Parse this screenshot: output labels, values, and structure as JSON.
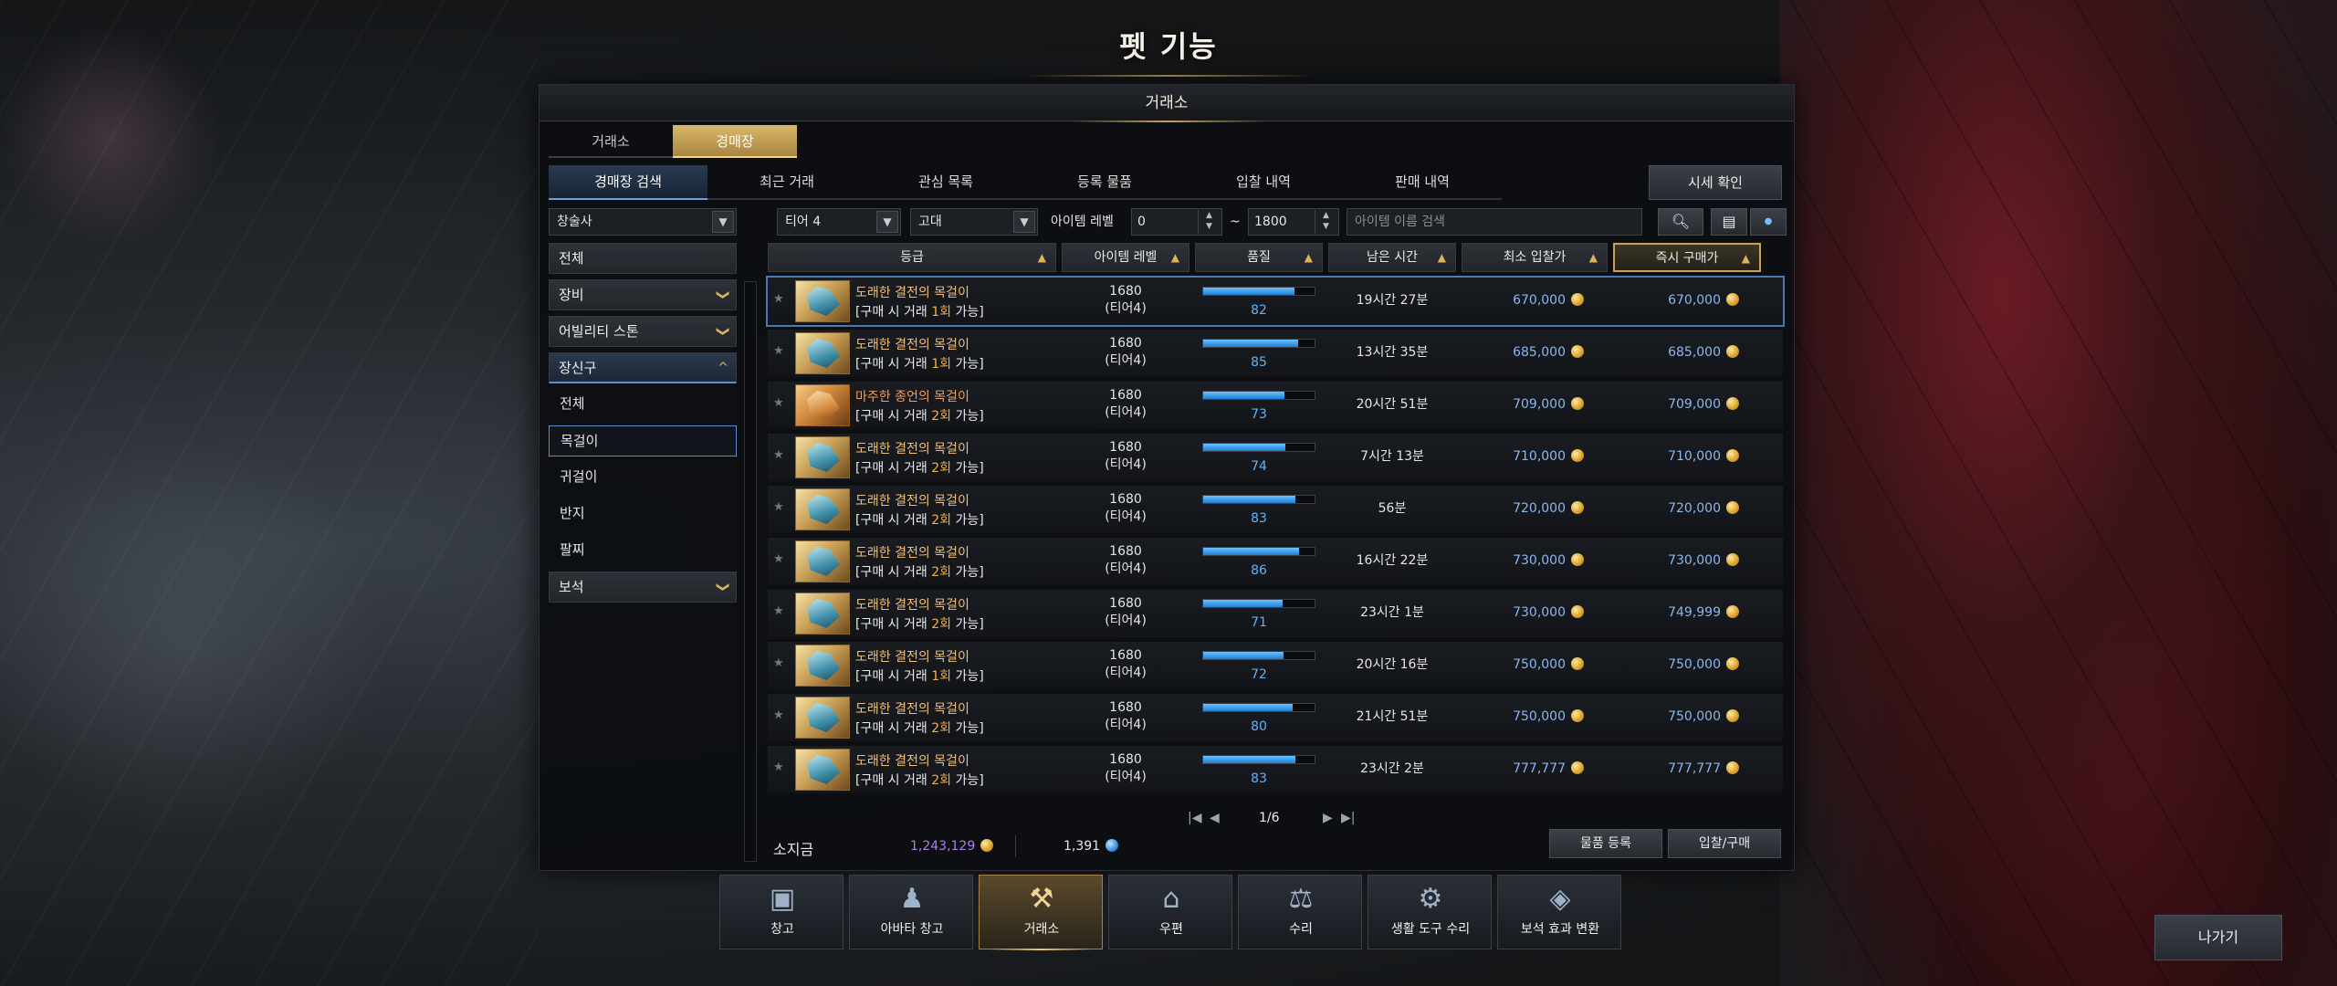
{
  "page_title": "펫 기능",
  "window_title": "거래소",
  "top_tabs": [
    {
      "label": "거래소",
      "active": false
    },
    {
      "label": "경매장",
      "active": true
    }
  ],
  "sub_tabs": [
    {
      "label": "경매장 검색",
      "active": true
    },
    {
      "label": "최근 거래",
      "active": false
    },
    {
      "label": "관심 목록",
      "active": false
    },
    {
      "label": "등록 물품",
      "active": false
    },
    {
      "label": "입찰 내역",
      "active": false
    },
    {
      "label": "판매 내역",
      "active": false
    }
  ],
  "price_check_label": "시세 확인",
  "filters": {
    "class_select": "창술사",
    "tier_select": "티어 4",
    "grade_select": "고대",
    "item_level_label": "아이템 레벨",
    "level_min": "0",
    "level_sep": "~",
    "level_max": "1800",
    "search_placeholder": "아이템 이름 검색",
    "search_icon": "search-icon",
    "detail_search_icon": "detail-search-icon",
    "toggle_dot": "●"
  },
  "sidebar": {
    "categories": [
      {
        "label": "전체",
        "type": "cat"
      },
      {
        "label": "장비",
        "type": "cat",
        "arrow": "❯"
      },
      {
        "label": "어빌리티 스톤",
        "type": "cat",
        "arrow": "❯"
      },
      {
        "label": "장신구",
        "type": "cat-open",
        "arrow": "^"
      },
      {
        "label": "전체",
        "type": "sub"
      },
      {
        "label": "목걸이",
        "type": "sub-selected"
      },
      {
        "label": "귀걸이",
        "type": "sub"
      },
      {
        "label": "반지",
        "type": "sub"
      },
      {
        "label": "팔찌",
        "type": "sub"
      },
      {
        "label": "보석",
        "type": "cat",
        "arrow": "❯"
      }
    ]
  },
  "table": {
    "headers": [
      "등급",
      "아이템 레벨",
      "품질",
      "남은 시간",
      "최소 입찰가",
      "즉시 구매가"
    ],
    "rows": [
      {
        "name": "도래한 결전의 목걸이",
        "trade_prefix": "[구매 시 거래 ",
        "trade_count": "1회",
        "trade_suffix": " 가능]",
        "level": "1680",
        "tier": "(티어4)",
        "quality": 82,
        "time": "19시간 27분",
        "min_bid": "670,000",
        "buyout": "670,000",
        "variant": "blue",
        "selected": true
      },
      {
        "name": "도래한 결전의 목걸이",
        "trade_prefix": "[구매 시 거래 ",
        "trade_count": "1회",
        "trade_suffix": " 가능]",
        "level": "1680",
        "tier": "(티어4)",
        "quality": 85,
        "time": "13시간 35분",
        "min_bid": "685,000",
        "buyout": "685,000",
        "variant": "blue",
        "selected": false
      },
      {
        "name": "마주한 종언의 목걸이",
        "trade_prefix": "[구매 시 거래 ",
        "trade_count": "2회",
        "trade_suffix": " 가능]",
        "level": "1680",
        "tier": "(티어4)",
        "quality": 73,
        "time": "20시간 51분",
        "min_bid": "709,000",
        "buyout": "709,000",
        "variant": "orange",
        "selected": false
      },
      {
        "name": "도래한 결전의 목걸이",
        "trade_prefix": "[구매 시 거래 ",
        "trade_count": "2회",
        "trade_suffix": " 가능]",
        "level": "1680",
        "tier": "(티어4)",
        "quality": 74,
        "time": "7시간 13분",
        "min_bid": "710,000",
        "buyout": "710,000",
        "variant": "blue",
        "selected": false
      },
      {
        "name": "도래한 결전의 목걸이",
        "trade_prefix": "[구매 시 거래 ",
        "trade_count": "2회",
        "trade_suffix": " 가능]",
        "level": "1680",
        "tier": "(티어4)",
        "quality": 83,
        "time": "56분",
        "min_bid": "720,000",
        "buyout": "720,000",
        "variant": "blue",
        "selected": false
      },
      {
        "name": "도래한 결전의 목걸이",
        "trade_prefix": "[구매 시 거래 ",
        "trade_count": "2회",
        "trade_suffix": " 가능]",
        "level": "1680",
        "tier": "(티어4)",
        "quality": 86,
        "time": "16시간 22분",
        "min_bid": "730,000",
        "buyout": "730,000",
        "variant": "blue",
        "selected": false
      },
      {
        "name": "도래한 결전의 목걸이",
        "trade_prefix": "[구매 시 거래 ",
        "trade_count": "2회",
        "trade_suffix": " 가능]",
        "level": "1680",
        "tier": "(티어4)",
        "quality": 71,
        "time": "23시간 1분",
        "min_bid": "730,000",
        "buyout": "749,999",
        "variant": "blue",
        "selected": false
      },
      {
        "name": "도래한 결전의 목걸이",
        "trade_prefix": "[구매 시 거래 ",
        "trade_count": "1회",
        "trade_suffix": " 가능]",
        "level": "1680",
        "tier": "(티어4)",
        "quality": 72,
        "time": "20시간 16분",
        "min_bid": "750,000",
        "buyout": "750,000",
        "variant": "blue",
        "selected": false
      },
      {
        "name": "도래한 결전의 목걸이",
        "trade_prefix": "[구매 시 거래 ",
        "trade_count": "2회",
        "trade_suffix": " 가능]",
        "level": "1680",
        "tier": "(티어4)",
        "quality": 80,
        "time": "21시간 51분",
        "min_bid": "750,000",
        "buyout": "750,000",
        "variant": "blue",
        "selected": false
      },
      {
        "name": "도래한 결전의 목걸이",
        "trade_prefix": "[구매 시 거래 ",
        "trade_count": "2회",
        "trade_suffix": " 가능]",
        "level": "1680",
        "tier": "(티어4)",
        "quality": 83,
        "time": "23시간 2분",
        "min_bid": "777,777",
        "buyout": "777,777",
        "variant": "blue",
        "selected": false
      }
    ]
  },
  "pager": {
    "first": "|◀",
    "prev": "◀",
    "page": "1/6",
    "next": "▶",
    "last": "▶|"
  },
  "footer": {
    "money_label": "소지금",
    "gold": "1,243,129",
    "crystal": "1,391",
    "register_label": "물품 등록",
    "bid_label": "입찰/구매"
  },
  "dock": [
    {
      "label": "창고",
      "icon": "chest-icon",
      "glyph": "▣",
      "active": false
    },
    {
      "label": "아바타 창고",
      "icon": "avatar-storage-icon",
      "glyph": "♟",
      "active": false
    },
    {
      "label": "거래소",
      "icon": "auction-hammer-icon",
      "glyph": "⚒",
      "active": true
    },
    {
      "label": "우편",
      "icon": "mail-icon",
      "glyph": "⌂",
      "active": false
    },
    {
      "label": "수리",
      "icon": "anvil-icon",
      "glyph": "⚖",
      "active": false
    },
    {
      "label": "생활 도구 수리",
      "icon": "life-tool-repair-icon",
      "glyph": "⚙",
      "active": false
    },
    {
      "label": "보석 효과 변환",
      "icon": "gem-convert-icon",
      "glyph": "◈",
      "active": false
    }
  ],
  "exit_label": "나가기",
  "colors": {
    "gold_accent": "#c9a35a",
    "blue_accent": "#5c8fd0",
    "price_blue": "#8ab8ee",
    "quality_blue": "#62b3f5",
    "trade_count_orange": "#f5b041",
    "money_purple": "#b07cf0"
  }
}
